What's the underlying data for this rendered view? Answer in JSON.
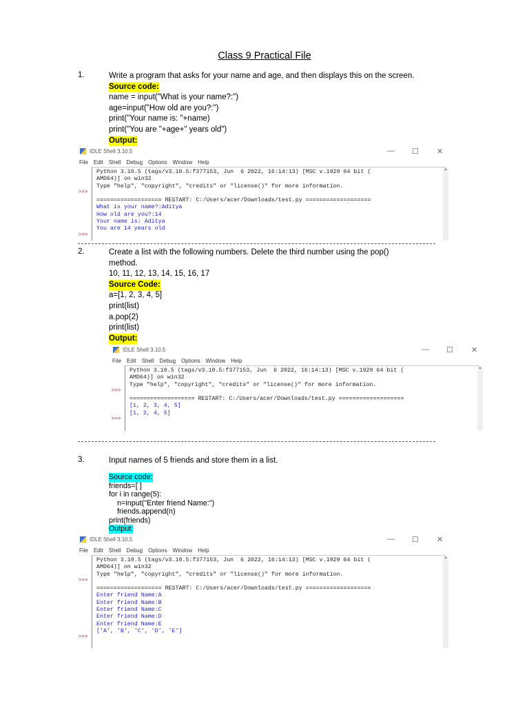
{
  "title": "Class 9 Practical File",
  "items": [
    {
      "number": "1.",
      "question": [
        "Write a program that asks for your name and age, and then displays this on the screen."
      ],
      "source_label": "Source code:",
      "code": [
        "name = input(\"What is your name?:\")",
        "age=input(\"How old are you?:\")",
        "print(\"Your name is: \"+name)",
        "print(\"You are \"+age+\" years old\")"
      ],
      "output_label": "Output:"
    },
    {
      "number": "2.",
      "question": [
        "Create a list with the following numbers. Delete the third number using the pop()",
        "method.",
        "10, 11, 12, 13, 14, 15, 16, 17"
      ],
      "source_label": "Source Code:",
      "code": [
        "a=[1, 2, 3, 4, 5]",
        "print(list)",
        "a.pop(2)",
        "print(list)"
      ],
      "output_label": "Output:"
    },
    {
      "number": "3.",
      "question": [
        "Input names of 5 friends and store them in a list."
      ],
      "source_label": "Source code:",
      "code": [
        "friends=[ ]",
        "for i in range(5):",
        "    n=input(\"Enter friend Name:\")",
        "    friends.append(n)",
        "print(friends)"
      ],
      "output_label": "Output:"
    }
  ],
  "separator": "------------------------------------------------------------------------------------------------------------------------------------------",
  "shell": {
    "title": "IDLE Shell 3.10.5",
    "minimize": "—",
    "maximize": "☐",
    "close": "✕",
    "menu": [
      "File",
      "Edit",
      "Shell",
      "Debug",
      "Options",
      "Window",
      "Help"
    ],
    "prompt": ">>>",
    "header": [
      "Python 3.10.5 (tags/v3.10.5:f377153, Jun  6 2022, 16:14:13) [MSC v.1929 64 bit (",
      "AMD64)] on win32",
      "Type \"help\", \"copyright\", \"credits\" or \"license()\" for more information."
    ],
    "restart": "=================== RESTART: C:/Users/acer/Downloads/test.py ==================="
  },
  "shells": [
    {
      "output": [
        "What is your name?:Aditya",
        "How old are you?:14",
        "Your name is: Aditya",
        "You are 14 years old"
      ]
    },
    {
      "output": [
        "[1, 2, 3, 4, 5]",
        "[1, 2, 4, 5]"
      ]
    },
    {
      "output": [
        "Enter friend Name:A",
        "Enter friend Name:B",
        "Enter friend Name:C",
        "Enter friend Name:D",
        "Enter friend Name:E",
        "['A', 'B', 'C', 'D', 'E']"
      ]
    }
  ],
  "colors": {
    "highlight_yellow": "#ffff00",
    "highlight_cyan": "#00ffff",
    "output_blue": "#2222dd",
    "prompt_red": "#a02030"
  }
}
